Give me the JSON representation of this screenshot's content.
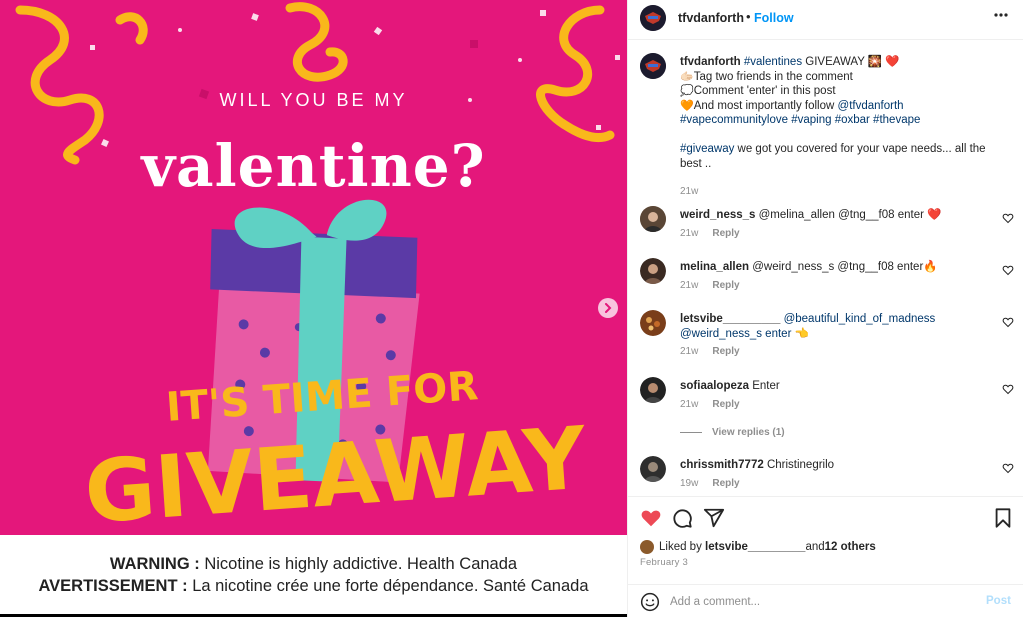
{
  "poster": {
    "subtitle": "WILL YOU BE MY",
    "title": "valentine?",
    "banner_line1": "IT'S TIME FOR",
    "banner_line2": "GIVEAWAY",
    "warning_bold_en": "WARNING :",
    "warning_text_en": " Nicotine is highly addictive. Health Canada",
    "warning_bold_fr": "AVERTISSEMENT :",
    "warning_text_fr": " La nicotine crée une forte dépendance. Santé Canada",
    "next_icon": "chevron-right-icon",
    "colors": {
      "background": "#e4177b",
      "ribbon": "#5fd1c4",
      "box_lid": "#5b3aa6",
      "box_body": "#e85aa4",
      "banner": "#f9b81b"
    }
  },
  "header": {
    "username": "tfvdanforth",
    "separator": "•",
    "follow": "Follow",
    "more_icon": "more-horizontal-icon"
  },
  "caption": {
    "username": "tfvdanforth",
    "line1_tag": "#valentines",
    "line1_text": " GIVEAWAY 🎇 ❤️",
    "line2": "Tag two friends in the comment",
    "line3": "Comment 'enter' in this post",
    "line4_text": "And most importantly follow ",
    "line4_tag": "@tfvdanforth",
    "hashtags": "#vapecommunitylove #vaping #oxbar #thevape",
    "line6_tag": "#giveaway",
    "line6_text": " we got you covered for your vape needs... all the best ..",
    "time": "21w"
  },
  "comments": [
    {
      "username": "weird_ness_s",
      "text": " @melina_allen @tng__f08 enter ❤️",
      "time": "21w",
      "reply": "Reply"
    },
    {
      "username": "melina_allen",
      "text": " @weird_ness_s @tng__f08 enter🔥",
      "time": "21w",
      "reply": "Reply"
    },
    {
      "username": "letsvibe_________",
      "text": " @beautiful_kind_of_madness @weird_ness_s enter 👈",
      "time": "21w",
      "reply": "Reply"
    },
    {
      "username": "sofiaalopeza",
      "text": " Enter",
      "time": "21w",
      "reply": "Reply",
      "view_replies": "View replies (1)"
    },
    {
      "username": "chrissmith7772",
      "text": " Christinegrilo",
      "time": "19w",
      "reply": "Reply"
    }
  ],
  "actions": {
    "like_icon": "heart-filled-icon",
    "comment_icon": "comment-icon",
    "share_icon": "share-icon",
    "save_icon": "bookmark-icon",
    "like_color": "#ed4956"
  },
  "likes": {
    "prefix": "Liked by ",
    "user": "letsvibe_________",
    "middle": " and ",
    "others": "12 others"
  },
  "date": "February 3",
  "comment_bar": {
    "placeholder": "Add a comment...",
    "post": "Post",
    "emoji_icon": "smiley-icon"
  }
}
